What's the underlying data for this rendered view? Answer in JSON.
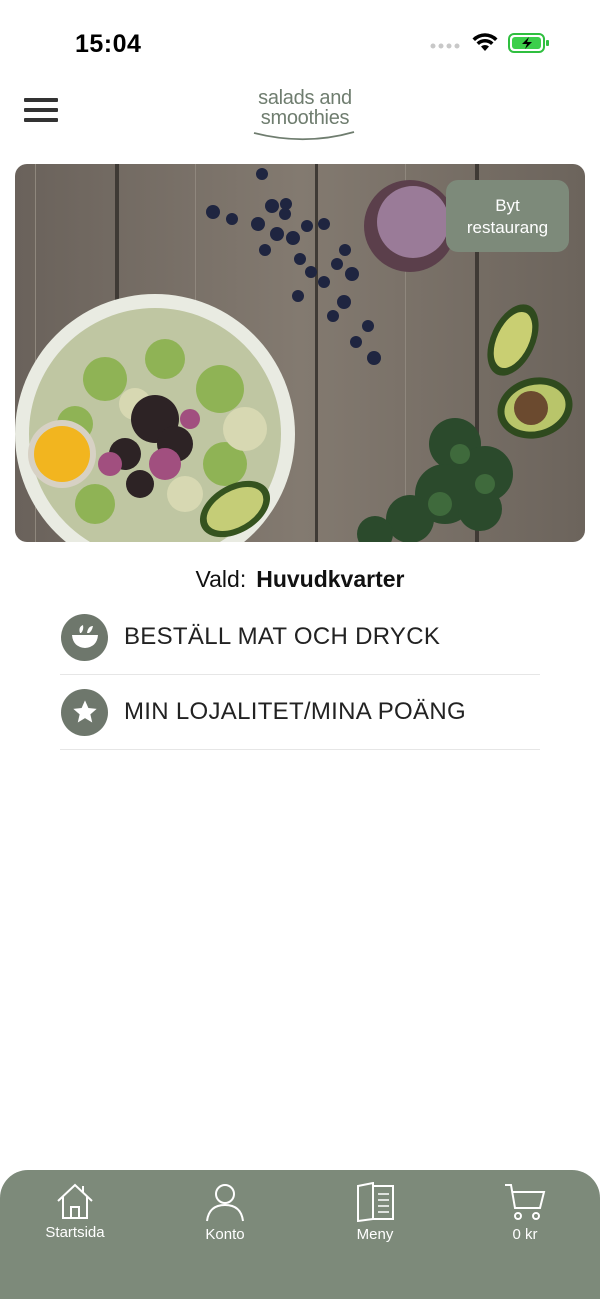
{
  "status": {
    "time": "15:04"
  },
  "header": {
    "logo_line1": "salads and",
    "logo_line2": "smoothies"
  },
  "hero": {
    "change_restaurant_line1": "Byt",
    "change_restaurant_line2": "restaurang"
  },
  "selected": {
    "label": "Vald:",
    "value": "Huvudkvarter"
  },
  "actions": [
    {
      "label": "BESTÄLL MAT OCH DRYCK",
      "icon": "bowl-icon"
    },
    {
      "label": "MIN LOJALITET/MINA POÄNG",
      "icon": "star-icon"
    }
  ],
  "tabbar": {
    "home": "Startsida",
    "account": "Konto",
    "menu": "Meny",
    "cart": "0 kr"
  },
  "colors": {
    "accent": "#7d8a7a",
    "icon_bg": "#6e776c",
    "logo": "#6f7d6f"
  }
}
